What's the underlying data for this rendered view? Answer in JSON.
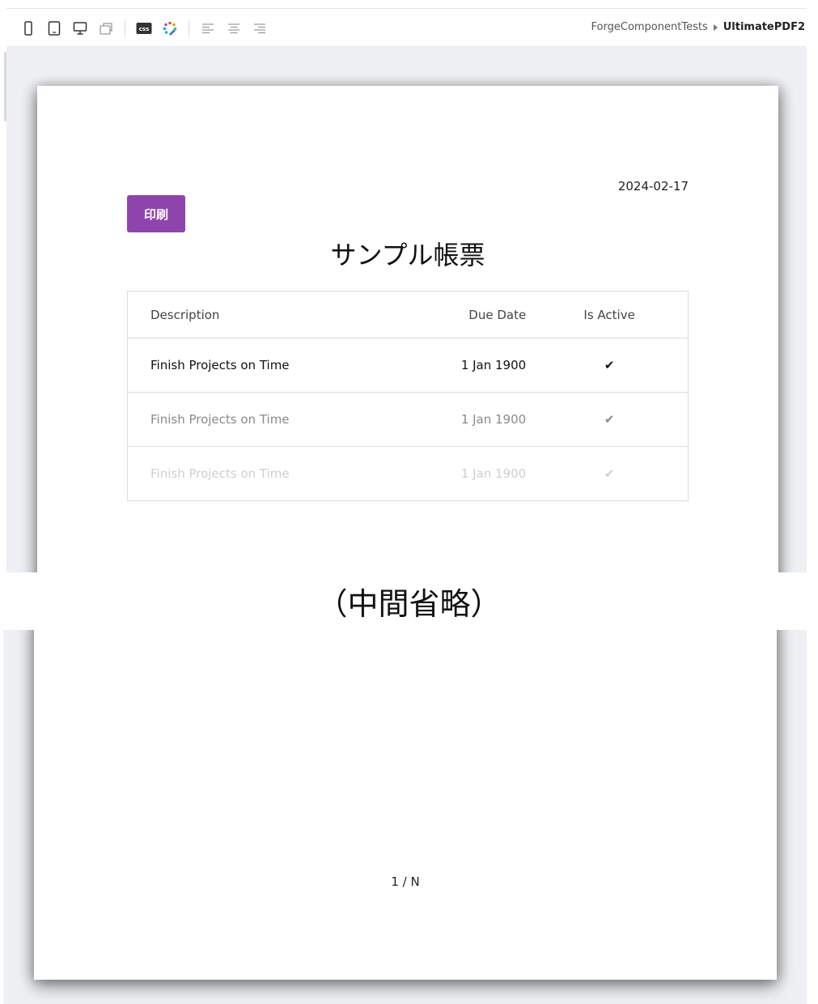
{
  "toolbar": {
    "icons": [
      "phone-icon",
      "tablet-icon",
      "desktop-icon",
      "page-layout-icon",
      "css-icon",
      "color-palette-icon",
      "align-left-icon",
      "align-center-icon",
      "align-right-icon"
    ],
    "css_label": "css"
  },
  "breadcrumb": {
    "parent": "ForgeComponentTests",
    "current": "UltimatePDF2"
  },
  "report": {
    "date": "2024-02-17",
    "print_label": "印刷",
    "title": "サンプル帳票",
    "table": {
      "headers": [
        "Description",
        "Due Date",
        "Is Active"
      ],
      "rows": [
        {
          "description": "Finish Projects on Time",
          "due_date": "1 Jan 1900",
          "is_active": "✔"
        },
        {
          "description": "Finish Projects on Time",
          "due_date": "1 Jan 1900",
          "is_active": "✔"
        },
        {
          "description": "Finish Projects on Time",
          "due_date": "1 Jan 1900",
          "is_active": "✔"
        }
      ]
    }
  },
  "omission_text": "（中間省略）",
  "footer": {
    "page_number": "1 / N"
  },
  "colors": {
    "accent": "#8e44ad",
    "workspace": "#eef0f3"
  }
}
